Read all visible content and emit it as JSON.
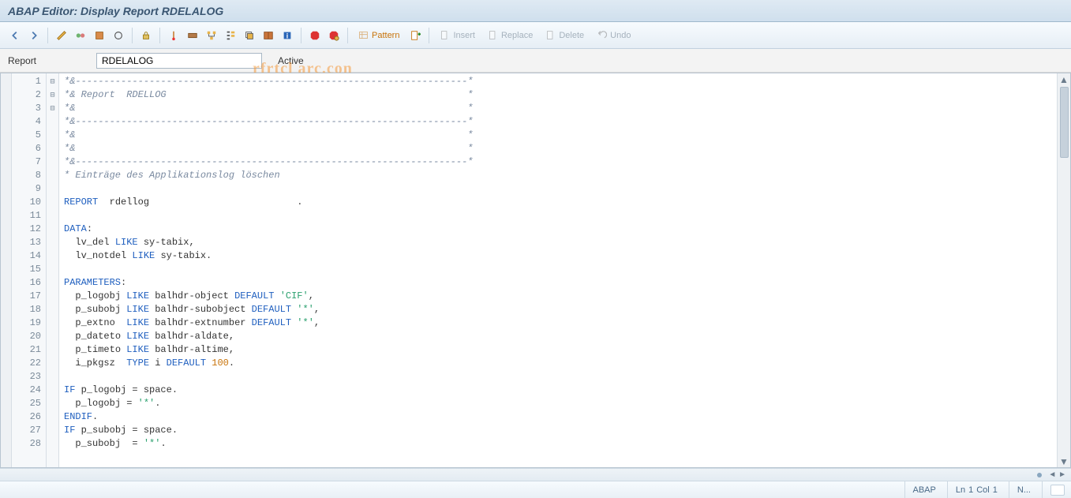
{
  "title": "ABAP Editor: Display Report RDELALOG",
  "toolbar": {
    "back_tip": "Back",
    "forward_tip": "Forward",
    "pattern_label": "Pattern",
    "insert_label": "Insert",
    "replace_label": "Replace",
    "delete_label": "Delete",
    "undo_label": "Undo"
  },
  "watermark_text": "rfrtcl arc.con",
  "report_row": {
    "label": "Report",
    "value": "RDELALOG",
    "status": "Active"
  },
  "code_lines": [
    {
      "n": 1,
      "fold": "⊟",
      "html": "<span class='cmt'>*&---------------------------------------------------------------------*</span>"
    },
    {
      "n": 2,
      "html": "<span class='cmt'>*& Report  RDELLOG                                                     *</span>"
    },
    {
      "n": 3,
      "html": "<span class='cmt'>*&                                                                     *</span>"
    },
    {
      "n": 4,
      "html": "<span class='cmt'>*&---------------------------------------------------------------------*</span>"
    },
    {
      "n": 5,
      "html": "<span class='cmt'>*&                                                                     *</span>"
    },
    {
      "n": 6,
      "html": "<span class='cmt'>*&                                                                     *</span>"
    },
    {
      "n": 7,
      "html": "<span class='cmt'>*&---------------------------------------------------------------------*</span>"
    },
    {
      "n": 8,
      "html": "<span class='cmt'>* Einträge des Applikationslog löschen</span>"
    },
    {
      "n": 9,
      "html": ""
    },
    {
      "n": 10,
      "html": "<span class='kw'>REPORT</span>  <span class='id'>rdellog</span>                          ."
    },
    {
      "n": 11,
      "html": ""
    },
    {
      "n": 12,
      "html": "<span class='kw'>DATA</span>:"
    },
    {
      "n": 13,
      "html": "  <span class='id'>lv_del</span> <span class='kw'>LIKE</span> <span class='id'>sy-tabix</span>,"
    },
    {
      "n": 14,
      "html": "  <span class='id'>lv_notdel</span> <span class='kw'>LIKE</span> <span class='id'>sy-tabix</span>."
    },
    {
      "n": 15,
      "html": ""
    },
    {
      "n": 16,
      "html": "<span class='kw'>PARAMETERS</span>:"
    },
    {
      "n": 17,
      "html": "  <span class='id'>p_logobj</span> <span class='kw'>LIKE</span> <span class='id'>balhdr-object</span> <span class='kw'>DEFAULT</span> <span class='str'>'CIF'</span>,"
    },
    {
      "n": 18,
      "html": "  <span class='id'>p_subobj</span> <span class='kw'>LIKE</span> <span class='id'>balhdr-subobject</span> <span class='kw'>DEFAULT</span> <span class='str'>'*'</span>,"
    },
    {
      "n": 19,
      "html": "  <span class='id'>p_extno</span>  <span class='kw'>LIKE</span> <span class='id'>balhdr-extnumber</span> <span class='kw'>DEFAULT</span> <span class='str'>'*'</span>,"
    },
    {
      "n": 20,
      "html": "  <span class='id'>p_dateto</span> <span class='kw'>LIKE</span> <span class='id'>balhdr-aldate</span>,"
    },
    {
      "n": 21,
      "html": "  <span class='id'>p_timeto</span> <span class='kw'>LIKE</span> <span class='id'>balhdr-altime</span>,"
    },
    {
      "n": 22,
      "html": "  <span class='id'>i_pkgsz</span>  <span class='kw'>TYPE</span> <span class='id'>i</span> <span class='kw'>DEFAULT</span> <span class='num'>100</span>."
    },
    {
      "n": 23,
      "html": ""
    },
    {
      "n": 24,
      "fold": "⊟",
      "html": "<span class='kw'>IF</span> <span class='id'>p_logobj</span> = <span class='id'>space</span>."
    },
    {
      "n": 25,
      "html": "  <span class='id'>p_logobj</span> = <span class='str'>'*'</span>."
    },
    {
      "n": 26,
      "html": "<span class='kw'>ENDIF</span>."
    },
    {
      "n": 27,
      "fold": "⊟",
      "html": "<span class='kw'>IF</span> <span class='id'>p_subobj</span> = <span class='id'>space</span>."
    },
    {
      "n": 28,
      "html": "  <span class='id'>p_subobj</span>  = <span class='str'>'*'</span>."
    }
  ],
  "statusbar": {
    "lang": "ABAP",
    "pos_prefix": "Ln",
    "line": "1",
    "col_prefix": "Col",
    "col": "1",
    "tail": "N..."
  }
}
